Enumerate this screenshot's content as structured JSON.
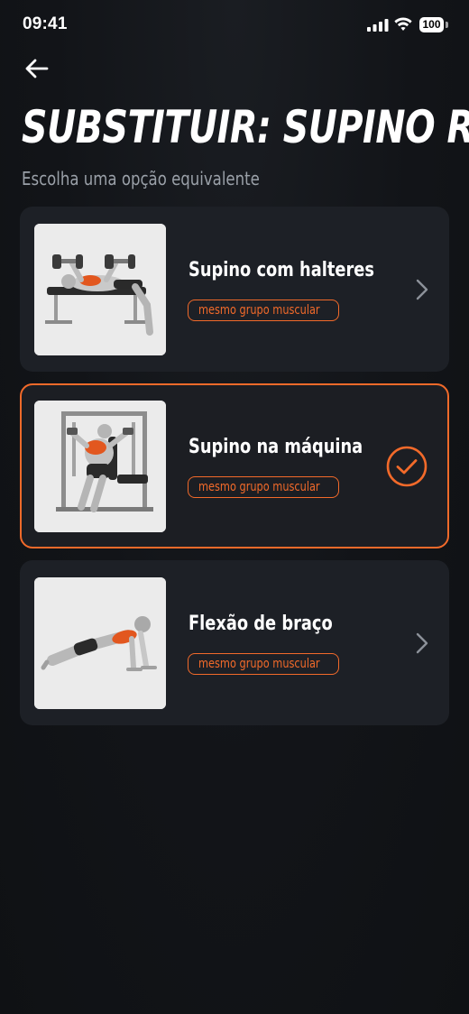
{
  "status_bar": {
    "time": "09:41",
    "battery": "100"
  },
  "header": {
    "title": "SUBSTITUIR: SUPINO RETO",
    "subtitle": "Escolha uma opção equivalente"
  },
  "options": [
    {
      "name": "Supino com halteres",
      "badge": "mesmo grupo muscular",
      "image": "dumbbell-bench-press-illustration",
      "selected": false
    },
    {
      "name": "Supino na máquina",
      "badge": "mesmo grupo muscular",
      "image": "machine-chest-press-illustration",
      "selected": true
    },
    {
      "name": "Flexão de braço",
      "badge": "mesmo grupo muscular",
      "image": "push-up-illustration",
      "selected": false
    }
  ],
  "icons": {
    "back": "arrow-left-icon",
    "chevron": "chevron-right-icon",
    "check": "check-circle-icon"
  },
  "colors": {
    "accent": "#f26a2a",
    "background": "#121418",
    "card": "#1d2026",
    "subtitle": "#9aa0a8"
  }
}
